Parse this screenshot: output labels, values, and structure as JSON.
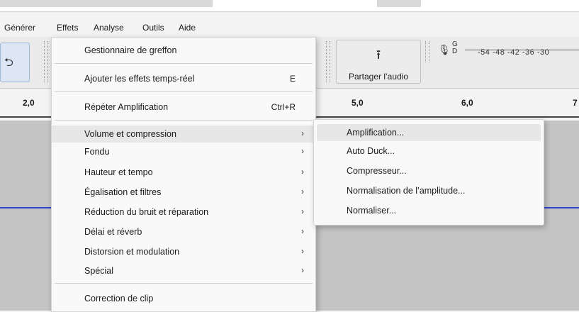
{
  "menubar": {
    "items": [
      "Générer",
      "Effets",
      "Analyse",
      "Outils",
      "Aide"
    ]
  },
  "toolbar": {
    "share_label": "Partager l’audio",
    "meter": {
      "channels": "G\nD",
      "scale": "-54 -48 -42 -36 -30"
    }
  },
  "ruler": {
    "ticks": [
      "2,0",
      "5,0",
      "6,0",
      "7"
    ]
  },
  "effects_menu": {
    "items": [
      {
        "label": "Gestionnaire de greffon",
        "shortcut": "",
        "submenu": false
      },
      {
        "label": "Ajouter les effets temps-réel",
        "shortcut": "E",
        "submenu": false
      },
      {
        "label": "Répéter Amplification",
        "shortcut": "Ctrl+R",
        "submenu": false
      },
      {
        "label": "Volume et compression",
        "shortcut": "",
        "submenu": true
      },
      {
        "label": "Fondu",
        "shortcut": "",
        "submenu": true
      },
      {
        "label": "Hauteur et tempo",
        "shortcut": "",
        "submenu": true
      },
      {
        "label": "Égalisation et filtres",
        "shortcut": "",
        "submenu": true
      },
      {
        "label": "Réduction du bruit et réparation",
        "shortcut": "",
        "submenu": true
      },
      {
        "label": "Délai et réverb",
        "shortcut": "",
        "submenu": true
      },
      {
        "label": "Distorsion et modulation",
        "shortcut": "",
        "submenu": true
      },
      {
        "label": "Spécial",
        "shortcut": "",
        "submenu": true
      },
      {
        "label": "Correction de clip",
        "shortcut": "",
        "submenu": false
      }
    ],
    "arrow": "›"
  },
  "volume_submenu": {
    "items": [
      "Amplification...",
      "Auto Duck...",
      "Compresseur...",
      "Normalisation de l’amplitude...",
      "Normaliser..."
    ]
  },
  "icons": {
    "share": "⭱",
    "mic": "🎙",
    "left_tool": "⮌"
  },
  "colors": {
    "waveform": "#2b3fd3",
    "menu_highlight": "#e7e7e7"
  }
}
